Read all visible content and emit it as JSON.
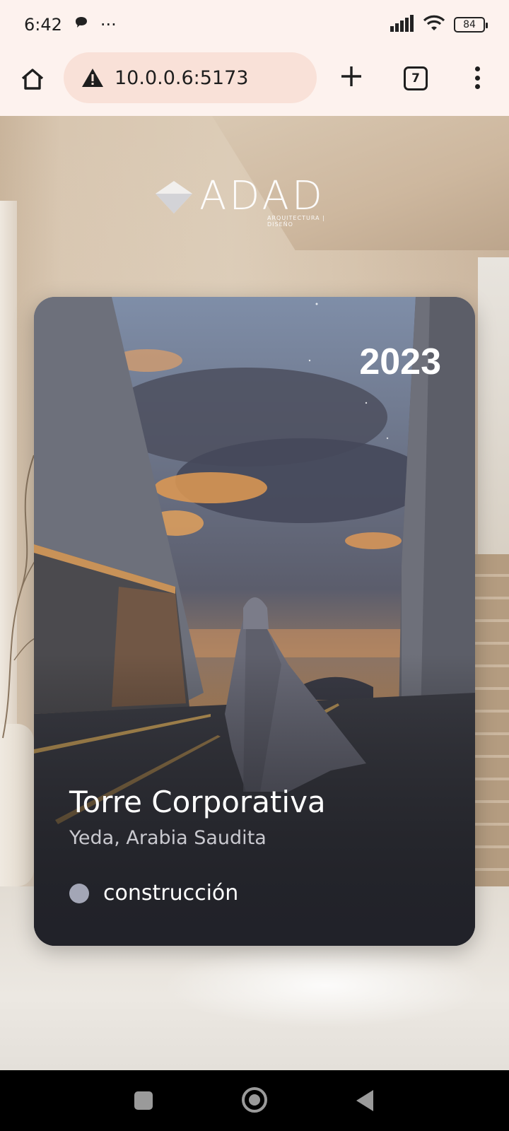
{
  "status_bar": {
    "time": "6:42",
    "overflow": "···",
    "battery": "84",
    "icons": [
      "chat-icon",
      "signal-icon",
      "wifi-icon",
      "battery-icon"
    ]
  },
  "browser": {
    "url": "10.0.0.6:5173",
    "tab_count": "7",
    "icons": [
      "home-icon",
      "warning-icon",
      "plus-icon",
      "tabs-icon",
      "more-vert-icon"
    ]
  },
  "page": {
    "logo": {
      "wordmark": "ADAD",
      "tagline": "ARQUITECTURA | DISEÑO"
    },
    "project_card": {
      "year": "2023",
      "title": "Torre Corporativa",
      "location": "Yeda, Arabia Saudita",
      "status": "construcción",
      "status_color": "#a3a6b6"
    }
  },
  "nav_bar": {
    "icons": [
      "recents-square-icon",
      "home-circle-icon",
      "back-triangle-icon"
    ]
  }
}
